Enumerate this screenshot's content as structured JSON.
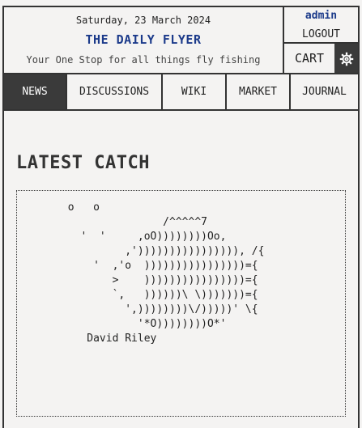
{
  "header": {
    "date": "Saturday, 23 March 2024",
    "title": "THE DAILY FLYER",
    "tagline": "Your One Stop for all things fly fishing"
  },
  "user": {
    "name": "admin",
    "logout_label": "LOGOUT",
    "cart_label": "CART",
    "settings_icon": "gear-icon"
  },
  "nav": {
    "items": [
      {
        "label": "NEWS",
        "active": true
      },
      {
        "label": "DISCUSSIONS",
        "active": false
      },
      {
        "label": "WIKI",
        "active": false
      },
      {
        "label": "MARKET",
        "active": false
      },
      {
        "label": "JOURNAL",
        "active": false
      }
    ]
  },
  "colors": {
    "accent": "#1b3a8a",
    "active_tab": "#3a3a3a",
    "background": "#f4f3f2"
  },
  "main": {
    "section_title": "LATEST CATCH",
    "ascii_art": "       o   o\n                      /^^^^^7\n         '  '     ,oO))))))))Oo,\n                ,')))))))))))))))), /{\n           '  ,'o  ))))))))))))))))={\n              >    ))))))))))))))))={\n              `,   ))))))\\ \\)))))))={\n                ',))))))))\\/)))))' \\{\n                  '*O))))))))O*'\n          David Riley"
  }
}
